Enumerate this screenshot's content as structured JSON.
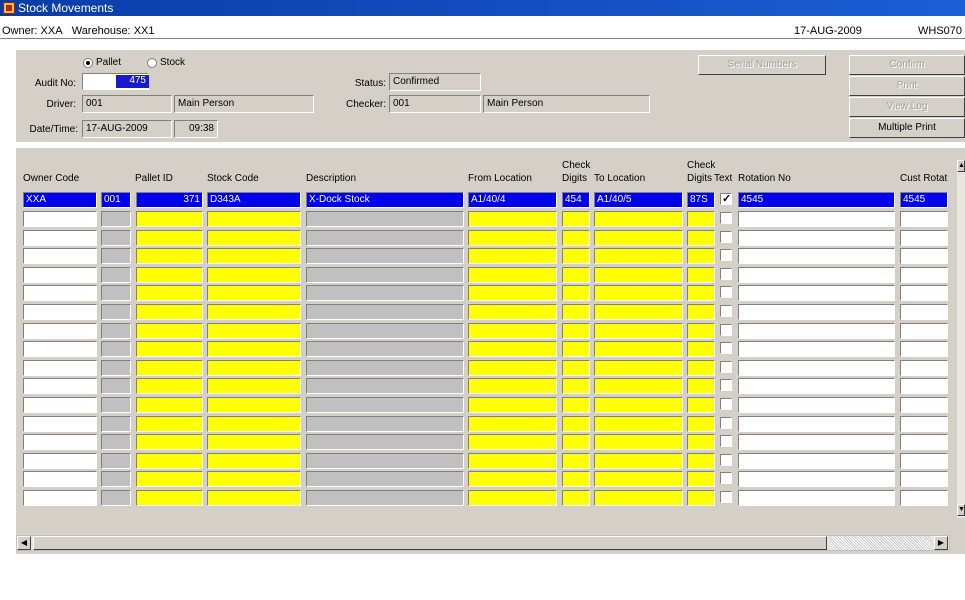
{
  "window": {
    "title": "Stock Movements"
  },
  "infobar": {
    "owner_label": "Owner:",
    "owner": "XXA",
    "warehouse_label": "Warehouse:",
    "warehouse": "XX1",
    "date": "17-AUG-2009",
    "form_id": "WHS070"
  },
  "header": {
    "radio_pallet": "Pallet",
    "radio_stock": "Stock",
    "selected_mode": "Pallet",
    "audit_label": "Audit No:",
    "audit_no": "475",
    "driver_label": "Driver:",
    "driver_code": "001",
    "driver_name": "Main Person",
    "datetime_label": "Date/Time:",
    "date": "17-AUG-2009",
    "time": "09:38",
    "status_label": "Status:",
    "status": "Confirmed",
    "checker_label": "Checker:",
    "checker_code": "001",
    "checker_name": "Main Person"
  },
  "buttons": {
    "serial_numbers": "Serial Numbers",
    "confirm": "Confirm",
    "print": "Print",
    "view_log": "View Log",
    "multiple_print": "Multiple Print"
  },
  "grid": {
    "headers": {
      "owner_code": "Owner Code",
      "pallet_id": "Pallet ID",
      "stock_code": "Stock Code",
      "description": "Description",
      "from_location": "From Location",
      "check_digits_1_top": "Check",
      "check_digits_1_bottom": "Digits",
      "to_location": "To Location",
      "check_digits_2_top": "Check",
      "check_digits_2_bottom": "Digits",
      "text": "Text",
      "rotation_no": "Rotation No",
      "cust_rotat": "Cust Rotat"
    },
    "rows": [
      {
        "owner_code": "XXA",
        "sub_code": "001",
        "pallet_id": "371",
        "stock_code": "D343A",
        "description": "X-Dock Stock",
        "from_location": "A1/40/4",
        "check_from": "454",
        "to_location": "A1/40/5",
        "check_to": "87S",
        "text": true,
        "rotation_no": "4545",
        "cust_rotat": "4545"
      }
    ],
    "empty_row_count": 16
  }
}
